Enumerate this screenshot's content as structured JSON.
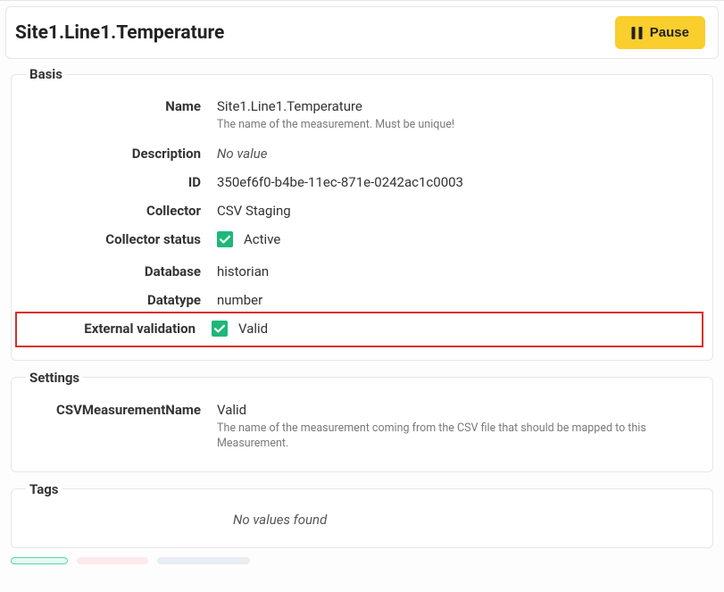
{
  "header": {
    "title": "Site1.Line1.Temperature",
    "pause_label": "Pause"
  },
  "basis": {
    "legend": "Basis",
    "name_label": "Name",
    "name_value": "Site1.Line1.Temperature",
    "name_helper": "The name of the measurement. Must be unique!",
    "description_label": "Description",
    "description_value": "No value",
    "id_label": "ID",
    "id_value": "350ef6f0-b4be-11ec-871e-0242ac1c0003",
    "collector_label": "Collector",
    "collector_value": "CSV Staging",
    "collector_status_label": "Collector status",
    "collector_status_value": "Active",
    "database_label": "Database",
    "database_value": "historian",
    "datatype_label": "Datatype",
    "datatype_value": "number",
    "ext_validation_label": "External validation",
    "ext_validation_value": "Valid"
  },
  "settings": {
    "legend": "Settings",
    "csv_name_label": "CSVMeasurementName",
    "csv_name_value": "Valid",
    "csv_name_helper": "The name of the measurement coming from the CSV file that should be mapped to this Measurement."
  },
  "tags": {
    "legend": "Tags",
    "empty_text": "No values found"
  }
}
